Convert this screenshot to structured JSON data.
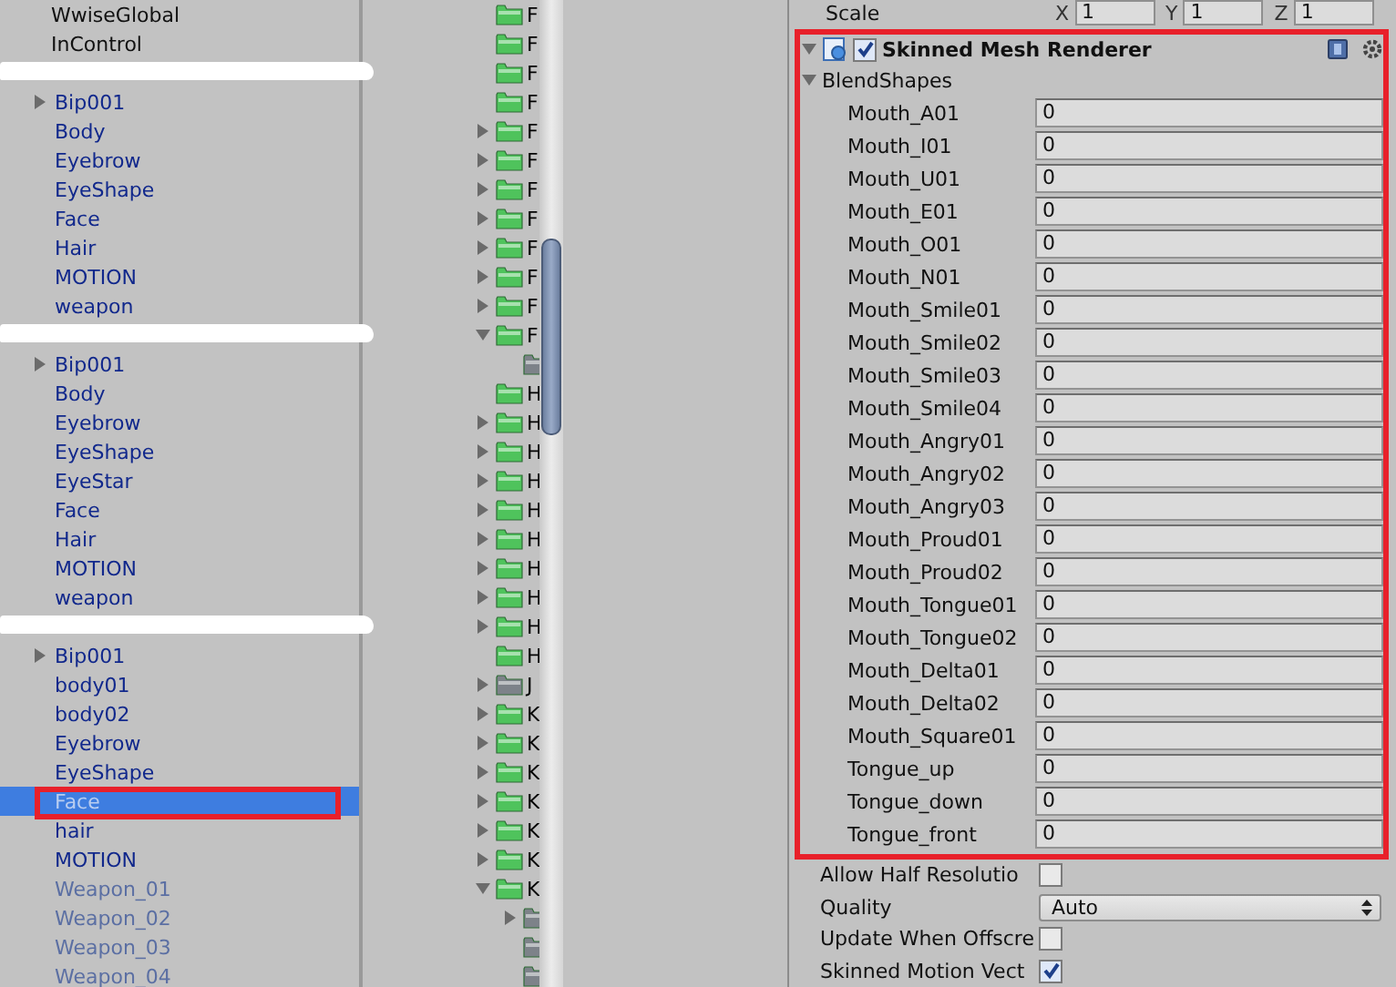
{
  "hierarchy": {
    "items": [
      {
        "kind": "object",
        "name": "WwiseGlobal",
        "prefab": false,
        "disabled": false,
        "selected": false,
        "annotated": false
      },
      {
        "kind": "object",
        "name": "InControl",
        "prefab": false,
        "disabled": false,
        "selected": false,
        "annotated": false
      },
      {
        "kind": "redacted",
        "children": [
          {
            "kind": "object",
            "name": "Bip001",
            "expanded": false,
            "prefab": true,
            "disabled": false,
            "selected": false,
            "annotated": false
          },
          {
            "kind": "object",
            "name": "Body",
            "prefab": true,
            "disabled": false,
            "selected": false,
            "annotated": false
          },
          {
            "kind": "object",
            "name": "Eyebrow",
            "prefab": true,
            "disabled": false,
            "selected": false,
            "annotated": false
          },
          {
            "kind": "object",
            "name": "EyeShape",
            "prefab": true,
            "disabled": false,
            "selected": false,
            "annotated": false
          },
          {
            "kind": "object",
            "name": "Face",
            "prefab": true,
            "disabled": false,
            "selected": false,
            "annotated": false
          },
          {
            "kind": "object",
            "name": "Hair",
            "prefab": true,
            "disabled": false,
            "selected": false,
            "annotated": false
          },
          {
            "kind": "object",
            "name": "MOTION",
            "prefab": true,
            "disabled": false,
            "selected": false,
            "annotated": false
          },
          {
            "kind": "object",
            "name": "weapon",
            "prefab": true,
            "disabled": false,
            "selected": false,
            "annotated": false
          }
        ]
      },
      {
        "kind": "redacted",
        "children": [
          {
            "kind": "object",
            "name": "Bip001",
            "expanded": false,
            "prefab": true,
            "disabled": false,
            "selected": false,
            "annotated": false
          },
          {
            "kind": "object",
            "name": "Body",
            "prefab": true,
            "disabled": false,
            "selected": false,
            "annotated": false
          },
          {
            "kind": "object",
            "name": "Eyebrow",
            "prefab": true,
            "disabled": false,
            "selected": false,
            "annotated": false
          },
          {
            "kind": "object",
            "name": "EyeShape",
            "prefab": true,
            "disabled": false,
            "selected": false,
            "annotated": false
          },
          {
            "kind": "object",
            "name": "EyeStar",
            "prefab": true,
            "disabled": false,
            "selected": false,
            "annotated": false
          },
          {
            "kind": "object",
            "name": "Face",
            "prefab": true,
            "disabled": false,
            "selected": false,
            "annotated": false
          },
          {
            "kind": "object",
            "name": "Hair",
            "prefab": true,
            "disabled": false,
            "selected": false,
            "annotated": false
          },
          {
            "kind": "object",
            "name": "MOTION",
            "prefab": true,
            "disabled": false,
            "selected": false,
            "annotated": false
          },
          {
            "kind": "object",
            "name": "weapon",
            "prefab": true,
            "disabled": false,
            "selected": false,
            "annotated": false
          }
        ]
      },
      {
        "kind": "redacted",
        "children": [
          {
            "kind": "object",
            "name": "Bip001",
            "expanded": false,
            "prefab": true,
            "disabled": false,
            "selected": false,
            "annotated": false
          },
          {
            "kind": "object",
            "name": "body01",
            "prefab": true,
            "disabled": false,
            "selected": false,
            "annotated": false
          },
          {
            "kind": "object",
            "name": "body02",
            "prefab": true,
            "disabled": false,
            "selected": false,
            "annotated": false
          },
          {
            "kind": "object",
            "name": "Eyebrow",
            "prefab": true,
            "disabled": false,
            "selected": false,
            "annotated": false
          },
          {
            "kind": "object",
            "name": "EyeShape",
            "prefab": true,
            "disabled": false,
            "selected": false,
            "annotated": false
          },
          {
            "kind": "object",
            "name": "Face",
            "prefab": true,
            "disabled": false,
            "selected": true,
            "annotated": true
          },
          {
            "kind": "object",
            "name": "hair",
            "prefab": true,
            "disabled": false,
            "selected": false,
            "annotated": false
          },
          {
            "kind": "object",
            "name": "MOTION",
            "prefab": true,
            "disabled": false,
            "selected": false,
            "annotated": false
          },
          {
            "kind": "object",
            "name": "Weapon_01",
            "prefab": true,
            "disabled": true,
            "selected": false,
            "annotated": false
          },
          {
            "kind": "object",
            "name": "Weapon_02",
            "prefab": true,
            "disabled": true,
            "selected": false,
            "annotated": false
          },
          {
            "kind": "object",
            "name": "Weapon_03",
            "prefab": true,
            "disabled": true,
            "selected": false,
            "annotated": false
          },
          {
            "kind": "object",
            "name": "Weapon_04",
            "prefab": true,
            "disabled": true,
            "selected": false,
            "annotated": false
          }
        ]
      }
    ]
  },
  "project": {
    "folders": [
      {
        "name": "F",
        "color": "#4fc35c"
      },
      {
        "name": "F",
        "color": "#4fc35c"
      },
      {
        "name": "F",
        "color": "#4fc35c"
      },
      {
        "name": "F",
        "color": "#4fc35c"
      },
      {
        "name": "F",
        "color": "#4fc35c",
        "expanded": false
      },
      {
        "name": "F",
        "color": "#4fc35c",
        "expanded": false
      },
      {
        "name": "F",
        "color": "#4fc35c",
        "expanded": false
      },
      {
        "name": "F",
        "color": "#4fc35c",
        "expanded": false
      },
      {
        "name": "F",
        "color": "#4fc35c",
        "expanded": false
      },
      {
        "name": "F",
        "color": "#4fc35c",
        "expanded": false
      },
      {
        "name": "F",
        "color": "#4fc35c",
        "expanded": false
      },
      {
        "name": "F",
        "color": "#4fc35c",
        "expanded": true,
        "children": [
          {
            "color": "#7d8289"
          }
        ]
      },
      {
        "name": "H",
        "color": "#4fc35c"
      },
      {
        "name": "H",
        "color": "#4fc35c",
        "expanded": false
      },
      {
        "name": "H",
        "color": "#4fc35c",
        "expanded": false
      },
      {
        "name": "H",
        "color": "#4fc35c",
        "expanded": false
      },
      {
        "name": "H",
        "color": "#4fc35c",
        "expanded": false
      },
      {
        "name": "H",
        "color": "#4fc35c",
        "expanded": false
      },
      {
        "name": "H",
        "color": "#4fc35c",
        "expanded": false
      },
      {
        "name": "H",
        "color": "#4fc35c",
        "expanded": false
      },
      {
        "name": "H",
        "color": "#4fc35c",
        "expanded": false
      },
      {
        "name": "H",
        "color": "#4fc35c"
      },
      {
        "name": "J",
        "color": "#7d8289",
        "expanded": false
      },
      {
        "name": "K",
        "color": "#4fc35c",
        "expanded": false
      },
      {
        "name": "K",
        "color": "#4fc35c",
        "expanded": false
      },
      {
        "name": "K",
        "color": "#4fc35c",
        "expanded": false
      },
      {
        "name": "K",
        "color": "#4fc35c",
        "expanded": false
      },
      {
        "name": "K",
        "color": "#4fc35c",
        "expanded": false
      },
      {
        "name": "K",
        "color": "#4fc35c",
        "expanded": false
      },
      {
        "name": "K",
        "color": "#4fc35c",
        "expanded": true,
        "children": [
          {
            "color": "#7d8289",
            "expanded": false
          },
          {
            "color": "#7d8289"
          },
          {
            "color": "#7d8289"
          }
        ]
      }
    ]
  },
  "inspector": {
    "scale": {
      "label": "Scale",
      "axes": [
        {
          "label": "X",
          "value": "1"
        },
        {
          "label": "Y",
          "value": "1"
        },
        {
          "label": "Z",
          "value": "1"
        }
      ]
    },
    "component": {
      "title": "Skinned Mesh Renderer",
      "expanded": true,
      "enabled": true,
      "annotated": true,
      "blendshapes": {
        "label": "BlendShapes",
        "expanded": true,
        "rows": [
          {
            "label": "Mouth_A01",
            "value": "0"
          },
          {
            "label": "Mouth_I01",
            "value": "0"
          },
          {
            "label": "Mouth_U01",
            "value": "0"
          },
          {
            "label": "Mouth_E01",
            "value": "0"
          },
          {
            "label": "Mouth_O01",
            "value": "0"
          },
          {
            "label": "Mouth_N01",
            "value": "0"
          },
          {
            "label": "Mouth_Smile01",
            "value": "0"
          },
          {
            "label": "Mouth_Smile02",
            "value": "0"
          },
          {
            "label": "Mouth_Smile03",
            "value": "0"
          },
          {
            "label": "Mouth_Smile04",
            "value": "0"
          },
          {
            "label": "Mouth_Angry01",
            "value": "0"
          },
          {
            "label": "Mouth_Angry02",
            "value": "0"
          },
          {
            "label": "Mouth_Angry03",
            "value": "0"
          },
          {
            "label": "Mouth_Proud01",
            "value": "0"
          },
          {
            "label": "Mouth_Proud02",
            "value": "0"
          },
          {
            "label": "Mouth_Tongue01",
            "value": "0"
          },
          {
            "label": "Mouth_Tongue02",
            "value": "0"
          },
          {
            "label": "Mouth_Delta01",
            "value": "0"
          },
          {
            "label": "Mouth_Delta02",
            "value": "0"
          },
          {
            "label": "Mouth_Square01",
            "value": "0"
          },
          {
            "label": "Tongue_up",
            "value": "0"
          },
          {
            "label": "Tongue_down",
            "value": "0"
          },
          {
            "label": "Tongue_front",
            "value": "0"
          }
        ]
      }
    },
    "properties": [
      {
        "kind": "checkbox",
        "label": "Allow Half Resolutio",
        "checked": false
      },
      {
        "kind": "dropdown",
        "label": "Quality",
        "value": "Auto"
      },
      {
        "kind": "checkbox",
        "label": "Update When Offscre",
        "checked": false
      },
      {
        "kind": "checkbox",
        "label": "Skinned Motion Vect",
        "checked": true
      }
    ]
  }
}
